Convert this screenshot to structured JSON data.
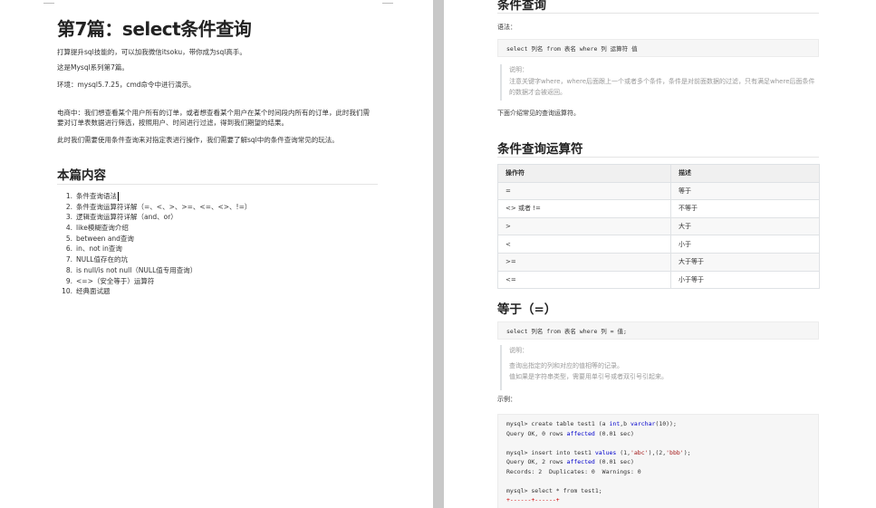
{
  "left": {
    "title": "第7篇：select条件查询",
    "intro": "打算提升sql技能的，可以加我微信itsoku，带你成为sql高手。",
    "series": "这是Mysql系列第7篇。",
    "env": "环境：mysql5.7.25，cmd命令中进行演示。",
    "para1": "电商中：我们想查看某个用户所有的订单，或者想查看某个用户在某个时间段内所有的订单，此时我们需要对订单表数据进行筛选，按照用户、时间进行过滤，得到我们期望的结果。",
    "para2": "此时我们需要使用条件查询来对指定表进行操作，我们需要了解sql中的条件查询常见的玩法。",
    "toc_title": "本篇内容",
    "toc": [
      {
        "num": "1.",
        "text": "条件查询语法"
      },
      {
        "num": "2.",
        "text": "条件查询运算符详解（=、<、>、>=、<=、<>、!=）"
      },
      {
        "num": "3.",
        "text": "逻辑查询运算符详解（and、or）"
      },
      {
        "num": "4.",
        "text": "like模糊查询介绍"
      },
      {
        "num": "5.",
        "text": "between and查询"
      },
      {
        "num": "6.",
        "text": "in、not in查询"
      },
      {
        "num": "7.",
        "text": "NULL值存在的坑"
      },
      {
        "num": "8.",
        "text": "is null/is not null（NULL值专用查询）"
      },
      {
        "num": "9.",
        "text": "<=>（安全等于）运算符"
      },
      {
        "num": "10.",
        "text": "经典面试题"
      }
    ]
  },
  "right": {
    "heading_top": "条件查询",
    "syntax_label": "语法：",
    "syntax_code": "select 列名 from 表名 where 列 运算符 值",
    "note1_title": "说明：",
    "note1_text": "注意关键字where，where后面跟上一个或者多个条件，条件是对前面数据的过滤，只有满足where后面条件的数据才会被返回。",
    "intro_ops": "下面介绍常见的查询运算符。",
    "ops_heading": "条件查询运算符",
    "table": {
      "headers": [
        "操作符",
        "描述"
      ],
      "rows": [
        [
          "=",
          "等于"
        ],
        [
          "<> 或者 !=",
          "不等于"
        ],
        [
          ">",
          "大于"
        ],
        [
          "<",
          "小于"
        ],
        [
          ">=",
          "大于等于"
        ],
        [
          "<=",
          "小于等于"
        ]
      ]
    },
    "eq_heading": "等于（=）",
    "eq_code": "select 列名 from 表名 where 列 = 值;",
    "note2_title": "说明：",
    "note2_line1": "查询出指定的列和对应的值相等的记录。",
    "note2_line2": "值如果是字符串类型，需要用单引号或者双引号引起来。",
    "example_label": "示例：",
    "code_lines": [
      {
        "a": "mysql> create table test1 (a ",
        "k1": "int",
        "b": ",b ",
        "k2": "varchar",
        "c": "(10));"
      },
      {
        "a": "Query OK, 0 rows ",
        "k1": "affected",
        "b": " (0.01 sec)",
        "k2": "",
        "c": ""
      },
      {
        "gap": true
      },
      {
        "a": "mysql> insert into test1 ",
        "k1": "values",
        "b": " (1,",
        "s1": "'abc'",
        "d": "),(2,",
        "s2": "'bbb'",
        "e": ");"
      },
      {
        "a": "Query OK, 2 rows ",
        "k1": "affected",
        "b": " (0.01 sec)"
      },
      {
        "a": "Records: 2  Duplicates: 0  Warnings: 0"
      },
      {
        "gap": true
      },
      {
        "a": "mysql> select * from test1;"
      },
      {
        "red": "+------+------+"
      }
    ]
  }
}
